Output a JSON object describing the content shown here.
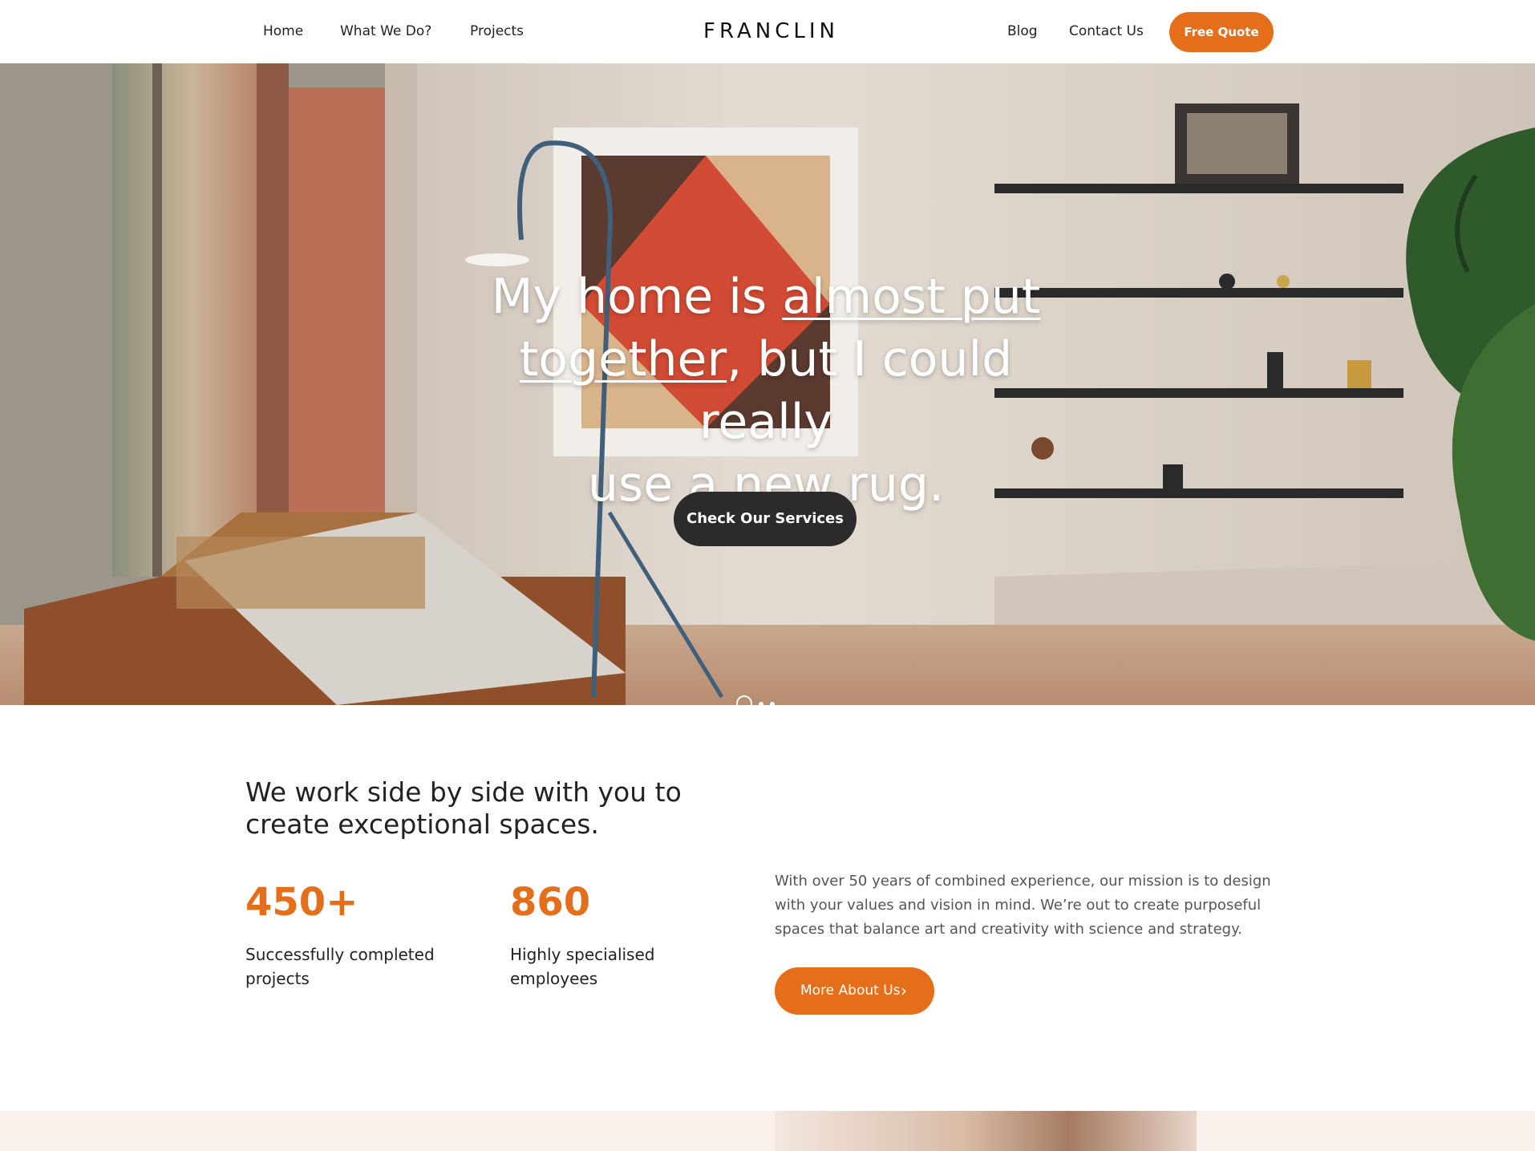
{
  "nav": {
    "home": "Home",
    "what_we_do": "What We Do?",
    "projects": "Projects",
    "logo": "FRANCLIN",
    "blog": "Blog",
    "contact": "Contact Us",
    "quote": "Free Quote"
  },
  "hero": {
    "line1_a": "My home is ",
    "line1_b": "almost put",
    "line2_a": "together",
    "line2_b": ", but I could really",
    "line3": "use a new rug.",
    "button": "Check Our Services"
  },
  "about": {
    "heading": "We work side by side with you to create exceptional spaces.",
    "stats": [
      {
        "number": "450+",
        "label": "Successfully completed projects"
      },
      {
        "number": "860",
        "label": "Highly specialised employees"
      }
    ],
    "text": "With over 50 years of combined experience, our mission is to design with your values and vision in mind. We’re out to create purposeful spaces that balance art and creativity with science and strategy.",
    "button": "More About Us"
  },
  "colors": {
    "accent": "#E56E1B",
    "dark_button": "#2b2b2b",
    "band": "#FAF0EC"
  }
}
